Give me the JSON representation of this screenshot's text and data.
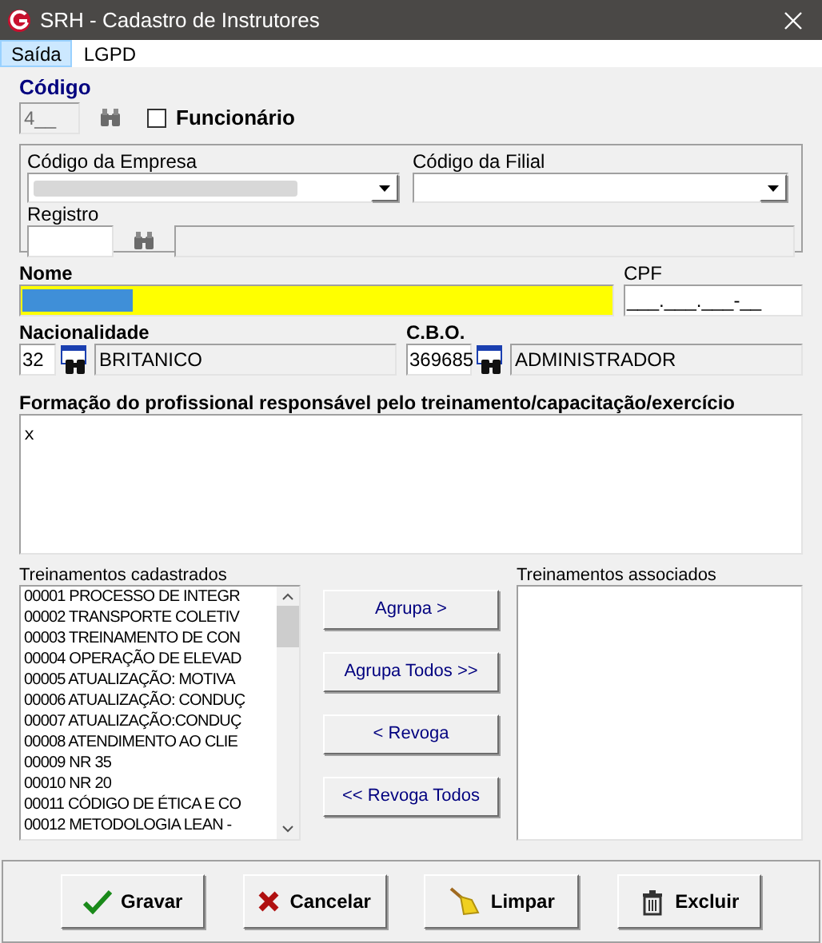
{
  "window": {
    "title": "SRH - Cadastro de Instrutores"
  },
  "menu": [
    {
      "label": "Saída",
      "selected": true
    },
    {
      "label": "LGPD",
      "selected": false
    }
  ],
  "codigo": {
    "label": "Código",
    "value": "4__"
  },
  "funcionario": {
    "label": "Funcionário",
    "checked": false
  },
  "empresa": {
    "label": "Código da Empresa"
  },
  "filial": {
    "label": "Código da Filial"
  },
  "registro": {
    "label": "Registro"
  },
  "nome": {
    "label": "Nome"
  },
  "cpf": {
    "label": "CPF",
    "value": "___.___.___-__"
  },
  "nacionalidade": {
    "label": "Nacionalidade",
    "code": "32",
    "name": "BRITANICO"
  },
  "cbo": {
    "label": "C.B.O.",
    "code": "369685",
    "name": "ADMINISTRADOR"
  },
  "formacao": {
    "label": "Formação do profissional responsável pelo treinamento/capacitação/exercício",
    "value": "x"
  },
  "cadastrados": {
    "label": "Treinamentos cadastrados",
    "items": [
      "00001 PROCESSO DE INTEGR",
      "00002 TRANSPORTE COLETIV",
      "00003 TREINAMENTO DE CON",
      "00004 OPERAÇÃO DE ELEVAD",
      "00005 ATUALIZAÇÃO: MOTIVA",
      "00006 ATUALIZAÇÃO: CONDUÇ",
      "00007 ATUALIZAÇÃO:CONDUÇ",
      "00008 ATENDIMENTO AO CLIE",
      "00009 NR 35",
      "00010 NR 20",
      "00011 CÓDIGO DE ÉTICA E CO",
      "00012 METODOLOGIA LEAN -"
    ]
  },
  "transfer_buttons": [
    "Agrupa >",
    "Agrupa Todos >>",
    "< Revoga",
    "<< Revoga Todos"
  ],
  "associados": {
    "label": "Treinamentos associados"
  },
  "actions": [
    {
      "kind": "save",
      "label": "Gravar"
    },
    {
      "kind": "cancel",
      "label": "Cancelar"
    },
    {
      "kind": "clear",
      "label": "Limpar"
    },
    {
      "kind": "delete",
      "label": "Excluir"
    }
  ]
}
